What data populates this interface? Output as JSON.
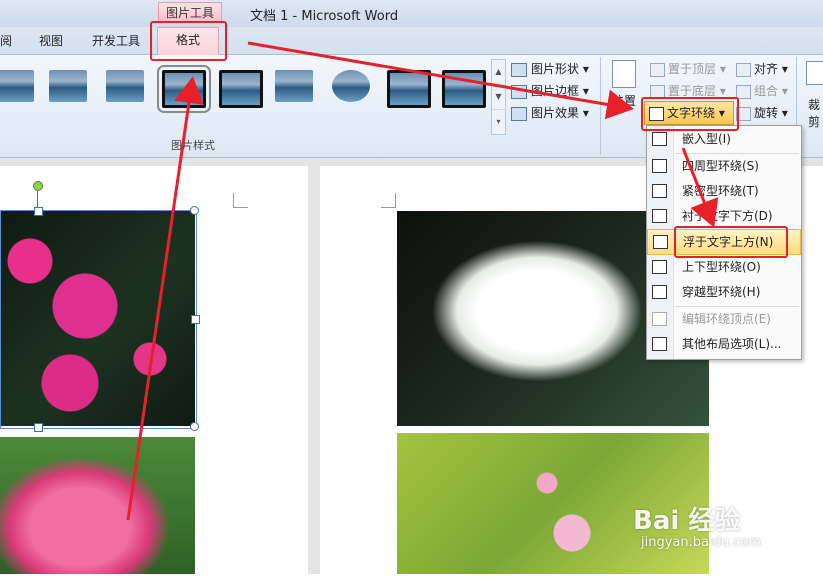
{
  "window": {
    "title": "文档 1 - Microsoft Word",
    "context_tab_group": "图片工具"
  },
  "tabs": [
    {
      "label": "阅"
    },
    {
      "label": "视图"
    },
    {
      "label": "开发工具"
    },
    {
      "label": "格式",
      "active": true
    }
  ],
  "ribbon": {
    "picture_styles_group_label": "图片样式",
    "picture_commands": [
      {
        "label": "图片形状",
        "icon": "picture-shape-icon"
      },
      {
        "label": "图片边框",
        "icon": "picture-border-icon"
      },
      {
        "label": "图片效果",
        "icon": "picture-effects-icon"
      }
    ],
    "position_label": "位置",
    "arrange": {
      "bring_to_front": "置于顶层",
      "send_to_back": "置于底层",
      "text_wrapping": "文字环绕",
      "align": "对齐",
      "group": "组合",
      "rotate": "旋转"
    },
    "crop_label": "裁剪"
  },
  "wrap_menu": {
    "items": [
      {
        "label": "嵌入型(I)",
        "enabled": true
      },
      {
        "label": "四周型环绕(S)",
        "enabled": true
      },
      {
        "label": "紧密型环绕(T)",
        "enabled": true
      },
      {
        "label": "衬于文字下方(D)",
        "enabled": true
      },
      {
        "label": "浮于文字上方(N)",
        "enabled": true,
        "highlighted": true
      },
      {
        "label": "上下型环绕(O)",
        "enabled": true
      },
      {
        "label": "穿越型环绕(H)",
        "enabled": true
      },
      {
        "label": "编辑环绕顶点(E)",
        "enabled": false
      },
      {
        "label": "其他布局选项(L)...",
        "enabled": true
      }
    ]
  },
  "watermark": {
    "brand": "Bai 经验",
    "url": "jingyan.baidu.com"
  },
  "colors": {
    "annotation_red": "#e8202a",
    "context_tab_pink": "#f7bccb",
    "menu_highlight": "#fddc7a"
  }
}
